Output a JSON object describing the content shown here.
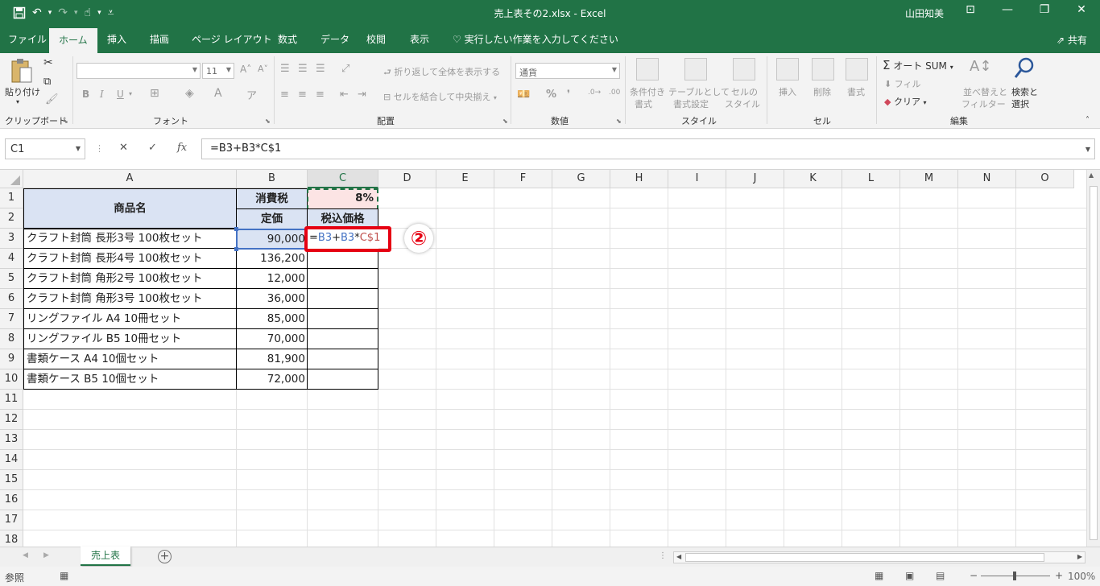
{
  "titlebar": {
    "filename": "売上表その2.xlsx",
    "app": "Excel",
    "title": "売上表その2.xlsx  -  Excel",
    "user": "山田知美",
    "icons": [
      "save-icon",
      "undo-icon",
      "redo-icon",
      "touch-mode-icon",
      "customize-qat-icon",
      "ribbon-display-icon",
      "minimize-icon",
      "restore-icon",
      "close-icon"
    ]
  },
  "tabs": {
    "file": "ファイル",
    "home": "ホーム",
    "insert": "挿入",
    "draw": "描画",
    "page_layout": "ページ レイアウト",
    "formulas": "数式",
    "data": "データ",
    "review": "校閲",
    "view": "表示",
    "tell_me": "実行したい作業を入力してください",
    "share": "共有"
  },
  "ribbon": {
    "clipboard": {
      "paste": "貼り付け",
      "label": "クリップボード"
    },
    "font": {
      "size": "11",
      "label": "フォント",
      "bold": "B",
      "italic": "I",
      "underline": "U"
    },
    "alignment": {
      "wrap": "折り返して全体を表示する",
      "merge": "セルを結合して中央揃え",
      "label": "配置"
    },
    "number": {
      "format": "通貨",
      "percent": "%",
      "label": "数値"
    },
    "styles": {
      "conditional_1": "条件付き",
      "conditional_2": "書式",
      "table_1": "テーブルとして",
      "table_2": "書式設定",
      "cell_1": "セルの",
      "cell_2": "スタイル",
      "label": "スタイル"
    },
    "cells": {
      "insert": "挿入",
      "delete": "削除",
      "format": "書式",
      "label": "セル"
    },
    "editing": {
      "autosum": "オート SUM",
      "fill": "フィル",
      "clear": "クリア",
      "sort_1": "並べ替えと",
      "sort_2": "フィルター",
      "find_1": "検索と",
      "find_2": "選択",
      "label": "編集"
    }
  },
  "formula_bar": {
    "name_box": "C1",
    "formula": "=B3+B3*C$1",
    "fx": "fx"
  },
  "grid": {
    "columns": [
      "A",
      "B",
      "C",
      "D",
      "E",
      "F",
      "G",
      "H",
      "I",
      "J",
      "K",
      "L",
      "M",
      "N",
      "O"
    ],
    "rows": [
      "1",
      "2",
      "3",
      "4",
      "5",
      "6",
      "7",
      "8",
      "9",
      "10",
      "11",
      "12",
      "13",
      "14",
      "15",
      "16",
      "17",
      "18"
    ],
    "header": {
      "product": "商品名",
      "tax_label": "消費税",
      "tax_rate": "8%",
      "list_price": "定価",
      "price_with_tax": "税込価格"
    },
    "products": [
      {
        "name": "クラフト封筒 長形3号 100枚セット",
        "price": "90,000"
      },
      {
        "name": "クラフト封筒 長形4号 100枚セット",
        "price": "136,200"
      },
      {
        "name": "クラフト封筒 角形2号 100枚セット",
        "price": "12,000"
      },
      {
        "name": "クラフト封筒 角形3号 100枚セット",
        "price": "36,000"
      },
      {
        "name": "リングファイル A4 10冊セット",
        "price": "85,000"
      },
      {
        "name": "リングファイル B5 10冊セット",
        "price": "70,000"
      },
      {
        "name": "書類ケース A4 10個セット",
        "price": "81,900"
      },
      {
        "name": "書類ケース B5 10個セット",
        "price": "72,000"
      }
    ],
    "editing_cell": {
      "eq": "=",
      "ref1": "B3",
      "plus": "+",
      "ref2": "B3",
      "times": "*",
      "ref3": "C$1"
    },
    "callout": "②"
  },
  "colors": {
    "excel_green": "#217346",
    "ref_blue": "#4472c4",
    "ref_red": "#c0504d",
    "highlight_red": "#e60012",
    "header_fill": "#dae3f3",
    "tax_fill": "#fce4e4"
  },
  "sheets": {
    "active": "売上表"
  },
  "statusbar": {
    "mode": "参照",
    "zoom": "100%"
  }
}
